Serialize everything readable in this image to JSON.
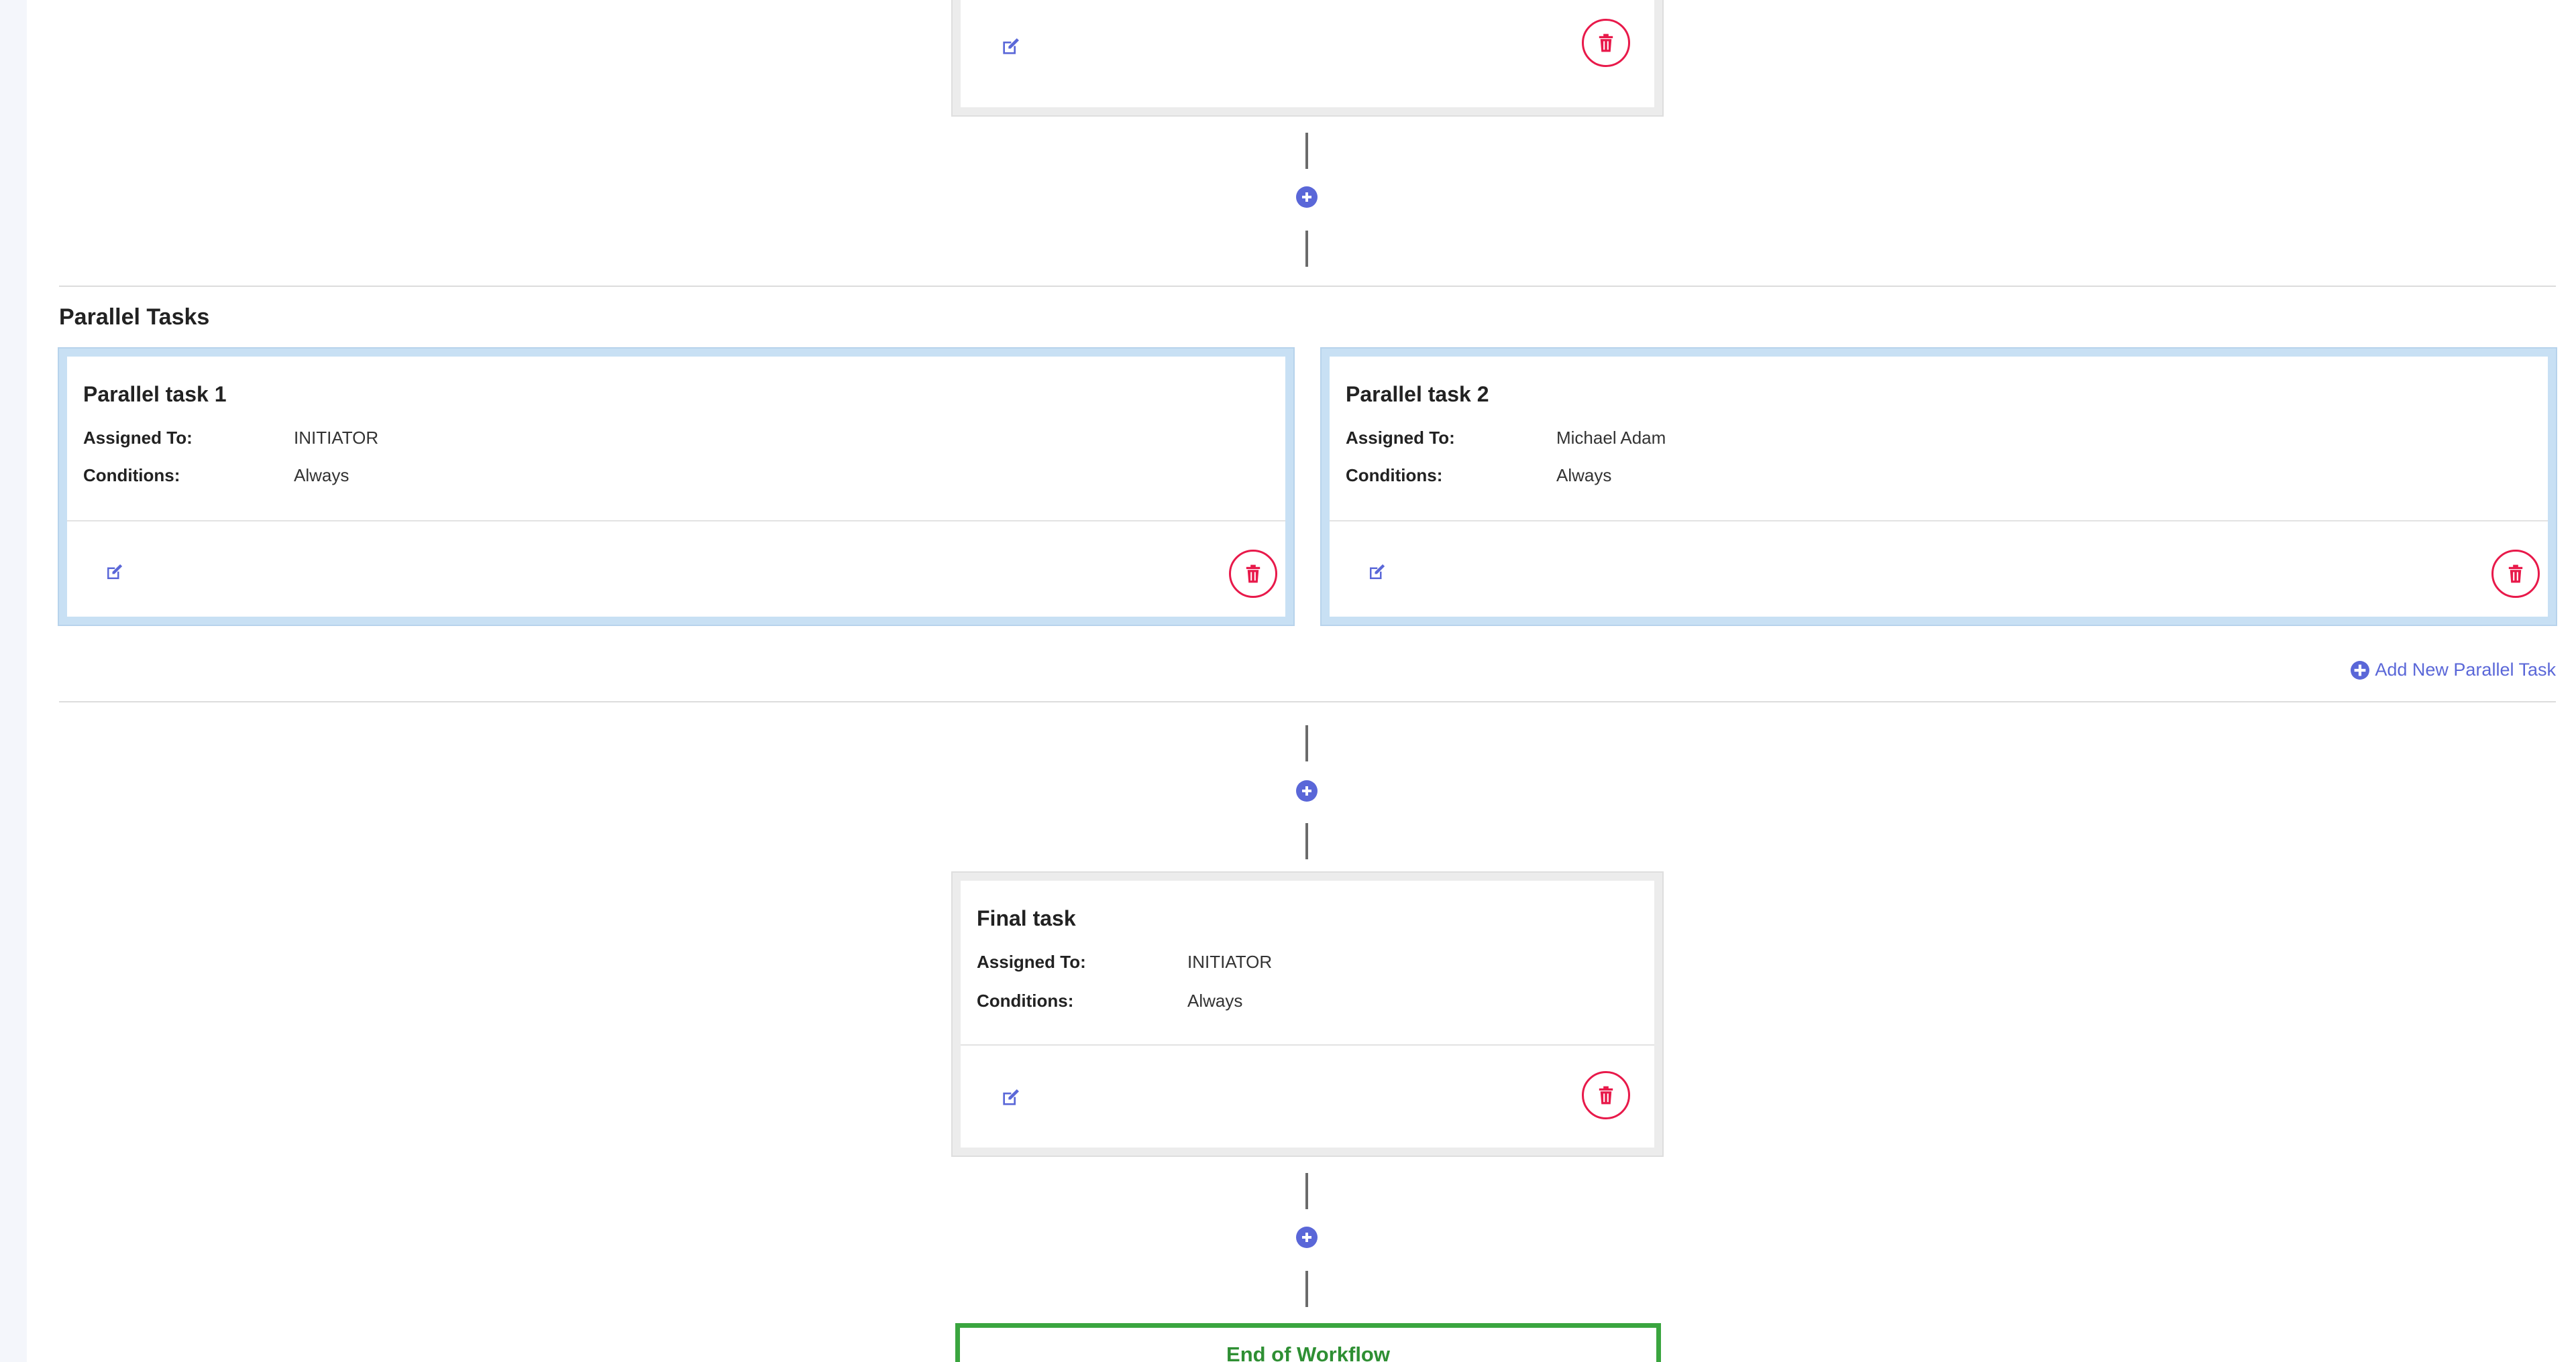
{
  "colors": {
    "accent": "#5a67d8",
    "delete": "#e8194a",
    "end_border": "#3aa53f",
    "parallel_border": "#c8e0f4"
  },
  "top_card": {
    "edit_icon": "edit-icon",
    "delete_icon": "trash-icon"
  },
  "parallel_section": {
    "title": "Parallel Tasks",
    "tasks": [
      {
        "title": "Parallel task 1",
        "assigned_label": "Assigned To:",
        "assigned_value": "INITIATOR",
        "conditions_label": "Conditions:",
        "conditions_value": "Always"
      },
      {
        "title": "Parallel task 2",
        "assigned_label": "Assigned To:",
        "assigned_value": "Michael Adam",
        "conditions_label": "Conditions:",
        "conditions_value": "Always"
      }
    ],
    "add_label": "Add New Parallel Task"
  },
  "final_task": {
    "title": "Final task",
    "assigned_label": "Assigned To:",
    "assigned_value": "INITIATOR",
    "conditions_label": "Conditions:",
    "conditions_value": "Always"
  },
  "end": {
    "label": "End of Workflow"
  }
}
